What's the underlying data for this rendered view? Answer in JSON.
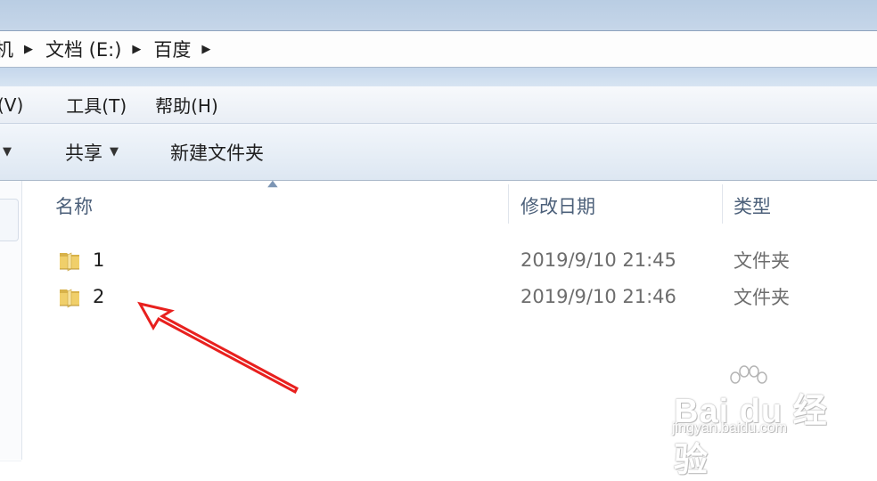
{
  "address": {
    "crumbs": [
      "机",
      "文档 (E:)",
      "百度"
    ]
  },
  "menu": {
    "items": [
      "(V)",
      "工具(T)",
      "帮助(H)"
    ]
  },
  "toolbar": {
    "share_label": "共享",
    "new_folder_label": "新建文件夹"
  },
  "columns": {
    "name": "名称",
    "date": "修改日期",
    "type": "类型"
  },
  "files": [
    {
      "name": "1",
      "date": "2019/9/10 21:45",
      "type": "文件夹",
      "icon": "folder-icon"
    },
    {
      "name": "2",
      "date": "2019/9/10 21:46",
      "type": "文件夹",
      "icon": "folder-icon"
    }
  ],
  "watermark": {
    "brand": "Bai du 经验",
    "url": "jingyan.baidu.com"
  },
  "colors": {
    "annotation_arrow": "#e8201e",
    "header_text": "#4c607a",
    "folder_yellow": "#f0cf6a"
  }
}
